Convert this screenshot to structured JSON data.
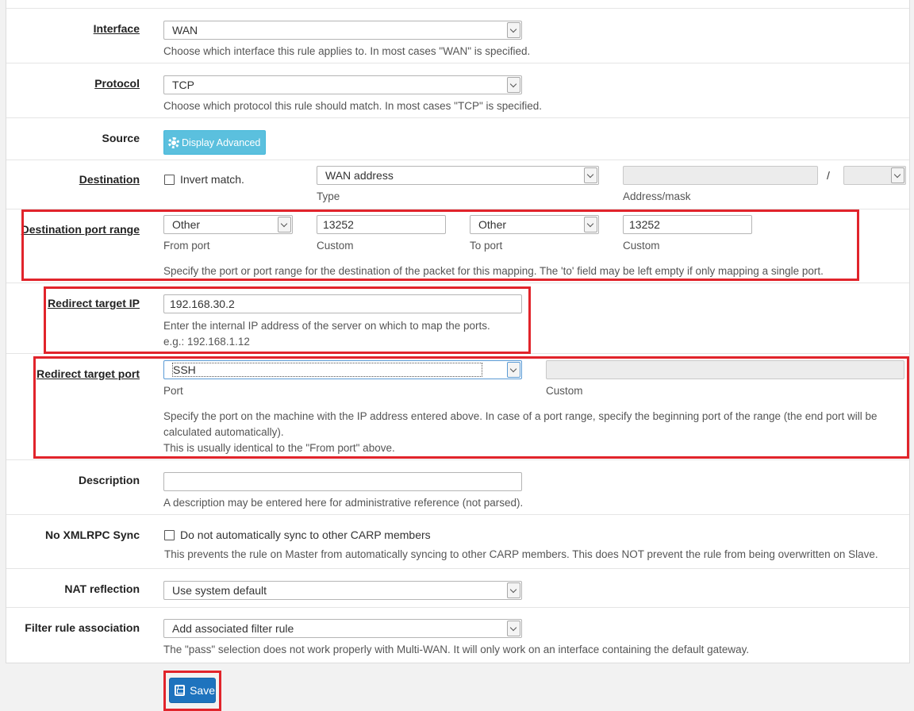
{
  "interface": {
    "label": "Interface",
    "value": "WAN",
    "help": "Choose which interface this rule applies to. In most cases \"WAN\" is specified."
  },
  "protocol": {
    "label": "Protocol",
    "value": "TCP",
    "help": "Choose which protocol this rule should match. In most cases \"TCP\" is specified."
  },
  "source": {
    "label": "Source",
    "button": "Display Advanced"
  },
  "destination": {
    "label": "Destination",
    "invert_label": "Invert match.",
    "type_value": "WAN address",
    "type_caption": "Type",
    "address_caption": "Address/mask",
    "slash": "/"
  },
  "dest_port_range": {
    "label": "Destination port range",
    "from_value": "Other",
    "from_caption": "From port",
    "from_custom": "13252",
    "from_custom_caption": "Custom",
    "to_value": "Other",
    "to_caption": "To port",
    "to_custom": "13252",
    "to_custom_caption": "Custom",
    "help": "Specify the port or port range for the destination of the packet for this mapping. The 'to' field may be left empty if only mapping a single port."
  },
  "redirect_ip": {
    "label": "Redirect target IP",
    "value": "192.168.30.2",
    "help1": "Enter the internal IP address of the server on which to map the ports.",
    "help2": "e.g.: 192.168.1.12"
  },
  "redirect_port": {
    "label": "Redirect target port",
    "value": "SSH",
    "port_caption": "Port",
    "custom_caption": "Custom",
    "help1": "Specify the port on the machine with the IP address entered above. In case of a port range, specify the beginning port of the range (the end port will be",
    "help2": "calculated automatically).",
    "help3": "This is usually identical to the \"From port\" above."
  },
  "description": {
    "label": "Description",
    "value": "",
    "help": "A description may be entered here for administrative reference (not parsed)."
  },
  "xmlrpc": {
    "label": "No XMLRPC Sync",
    "checkbox_label": "Do not automatically sync to other CARP members",
    "help": "This prevents the rule on Master from automatically syncing to other CARP members. This does NOT prevent the rule from being overwritten on Slave."
  },
  "nat_reflection": {
    "label": "NAT reflection",
    "value": "Use system default"
  },
  "filter_rule": {
    "label": "Filter rule association",
    "value": "Add associated filter rule",
    "help": "The \"pass\" selection does not work properly with Multi-WAN. It will only work on an interface containing the default gateway."
  },
  "save": {
    "label": "Save"
  },
  "colors": {
    "highlight": "#e1242b",
    "save_button": "#1e73be",
    "advanced_button": "#5bc0de"
  }
}
